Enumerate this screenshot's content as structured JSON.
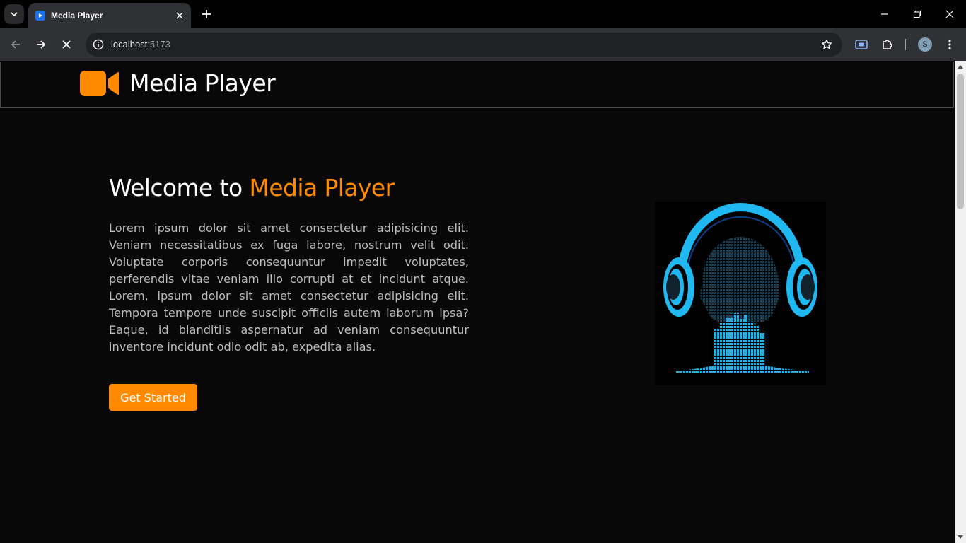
{
  "browser": {
    "tab_title": "Media Player",
    "url_host": "localhost",
    "url_port": ":5173",
    "profile_initial": "S",
    "icons": [
      "tab-search-icon",
      "close-icon",
      "plus-icon",
      "minimize-icon",
      "restore-icon",
      "back-arrow-icon",
      "forward-arrow-icon",
      "stop-icon",
      "info-icon",
      "star-icon",
      "screencast-icon",
      "puzzle-icon",
      "more-vert-icon"
    ]
  },
  "header": {
    "brand_name": "Media Player",
    "brand_icon": "video-camera-icon",
    "accent_color": "#ff8a00"
  },
  "hero": {
    "title_prefix": "Welcome to ",
    "title_accent": "Media Player",
    "description": "Lorem ipsum dolor sit amet consectetur adipisicing elit. Veniam necessitatibus ex fuga labore, nostrum velit odit. Voluptate corporis consequuntur impedit voluptates, perferendis vitae veniam illo corrupti at et incidunt atque. Lorem, ipsum dolor sit amet consectetur adipisicing elit. Tempora tempore unde suscipit officiis autem laborum ipsa? Eaque, id blanditiis aspernatur ad veniam consequuntur inventore incidunt odio odit ab, expedita alias.",
    "cta_label": "Get Started",
    "image": "headphones-silhouette-illustration",
    "image_color": "#00aaee"
  }
}
